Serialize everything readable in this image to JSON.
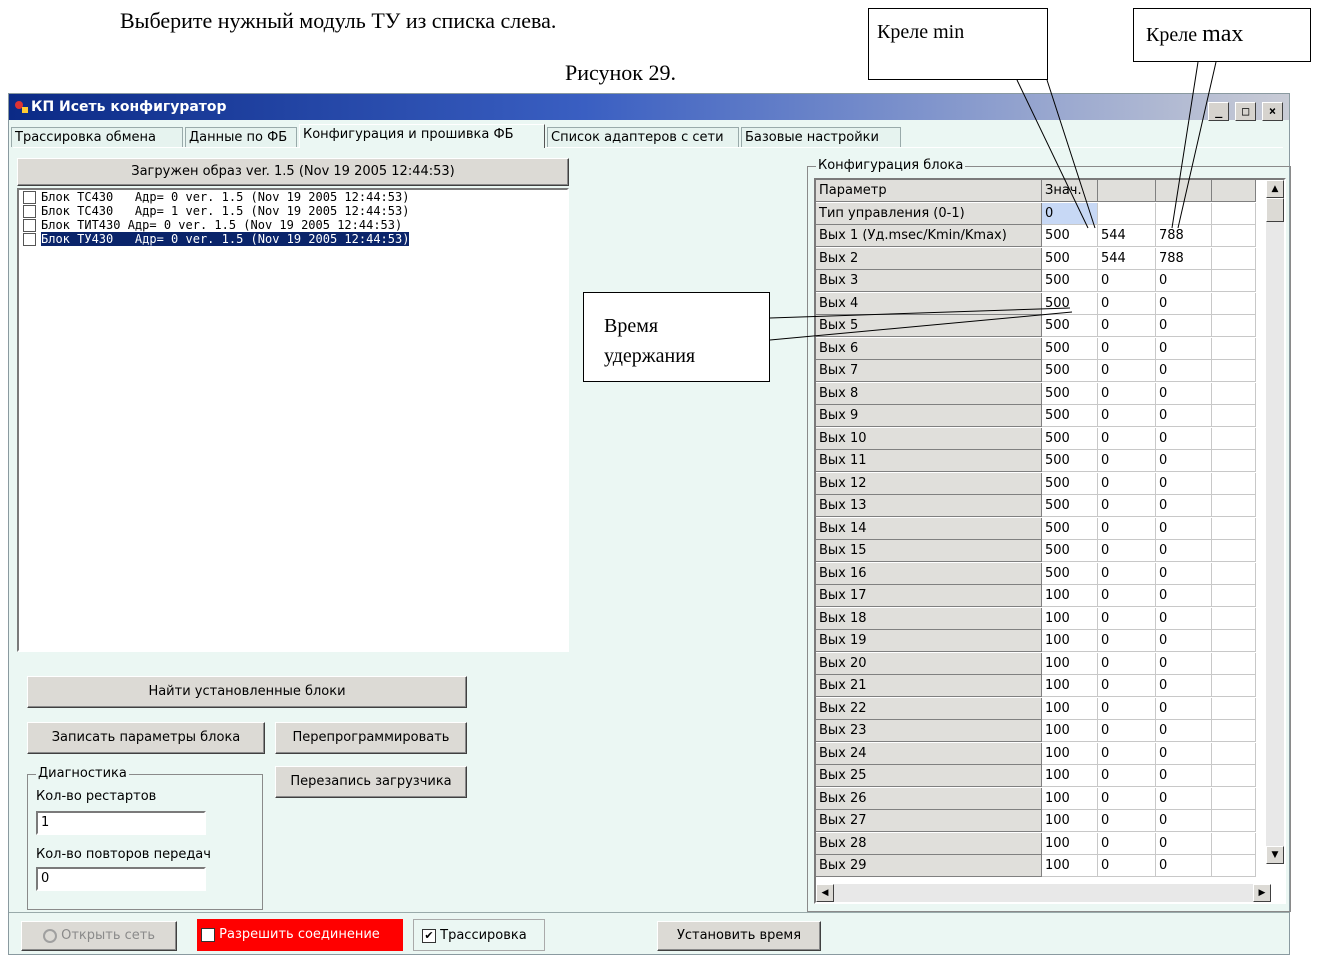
{
  "document": {
    "instruction": "Выберите нужный модуль ТУ из списка слева.",
    "figure_caption": "Рисунок 29."
  },
  "callouts": {
    "krele_min": "Креле min",
    "krele_max_prefix": "Креле ",
    "krele_max_suffix": "max",
    "hold_time_line1": "Время",
    "hold_time_line2": "удержания"
  },
  "window": {
    "title": "КП Исеть конфигуратор",
    "minimize": "_",
    "maximize": "□",
    "close": "×"
  },
  "tabs": [
    {
      "label": "Трассировка обмена"
    },
    {
      "label": "Данные по ФБ"
    },
    {
      "label": "Конфигурация и прошивка ФБ"
    },
    {
      "label": "Список адаптеров с сети"
    },
    {
      "label": "Базовые настройки"
    }
  ],
  "left": {
    "image_loaded": "Загружен образ  ver. 1.5 (Nov 19 2005 12:44:53)",
    "blocks": [
      "Блок ТС430   Адр= 0 ver. 1.5 (Nov 19 2005 12:44:53)",
      "Блок ТС430   Адр= 1 ver. 1.5 (Nov 19 2005 12:44:53)",
      "Блок ТИТ430 Адр= 0 ver. 1.5 (Nov 19 2005 12:44:53)",
      "Блок ТУ430   Адр= 0 ver. 1.5 (Nov 19 2005 12:44:53)"
    ],
    "find_blocks": "Найти установленные блоки",
    "write_params": "Записать параметры блока",
    "reprogram": "Перепрограммировать",
    "rewrite_loader": "Перезапись загрузчика",
    "diagnostics": {
      "title": "Диагностика",
      "restarts_label": "Кол-во рестартов",
      "restarts_value": "1",
      "retries_label": "Кол-во повторов передач",
      "retries_value": "0"
    }
  },
  "config": {
    "title": "Конфигурация блока",
    "headers": [
      "Параметр",
      "Знач.",
      "",
      "",
      ""
    ],
    "rows": [
      [
        "Тип управления (0-1)",
        "0",
        "",
        "",
        ""
      ],
      [
        "Вых 1 (Уд.msec/Kmin/Kmax)",
        "500",
        "544",
        "788",
        ""
      ],
      [
        "Вых 2",
        "500",
        "544",
        "788",
        ""
      ],
      [
        "Вых 3",
        "500",
        "0",
        "0",
        ""
      ],
      [
        "Вых 4",
        "500",
        "0",
        "0",
        ""
      ],
      [
        "Вых 5",
        "500",
        "0",
        "0",
        ""
      ],
      [
        "Вых 6",
        "500",
        "0",
        "0",
        ""
      ],
      [
        "Вых 7",
        "500",
        "0",
        "0",
        ""
      ],
      [
        "Вых 8",
        "500",
        "0",
        "0",
        ""
      ],
      [
        "Вых 9",
        "500",
        "0",
        "0",
        ""
      ],
      [
        "Вых 10",
        "500",
        "0",
        "0",
        ""
      ],
      [
        "Вых 11",
        "500",
        "0",
        "0",
        ""
      ],
      [
        "Вых 12",
        "500",
        "0",
        "0",
        ""
      ],
      [
        "Вых 13",
        "500",
        "0",
        "0",
        ""
      ],
      [
        "Вых 14",
        "500",
        "0",
        "0",
        ""
      ],
      [
        "Вых 15",
        "500",
        "0",
        "0",
        ""
      ],
      [
        "Вых 16",
        "500",
        "0",
        "0",
        ""
      ],
      [
        "Вых 17",
        "100",
        "0",
        "0",
        ""
      ],
      [
        "Вых 18",
        "100",
        "0",
        "0",
        ""
      ],
      [
        "Вых 19",
        "100",
        "0",
        "0",
        ""
      ],
      [
        "Вых 20",
        "100",
        "0",
        "0",
        ""
      ],
      [
        "Вых 21",
        "100",
        "0",
        "0",
        ""
      ],
      [
        "Вых 22",
        "100",
        "0",
        "0",
        ""
      ],
      [
        "Вых 23",
        "100",
        "0",
        "0",
        ""
      ],
      [
        "Вых 24",
        "100",
        "0",
        "0",
        ""
      ],
      [
        "Вых 25",
        "100",
        "0",
        "0",
        ""
      ],
      [
        "Вых 26",
        "100",
        "0",
        "0",
        ""
      ],
      [
        "Вых 27",
        "100",
        "0",
        "0",
        ""
      ],
      [
        "Вых 28",
        "100",
        "0",
        "0",
        ""
      ],
      [
        "Вых 29",
        "100",
        "0",
        "0",
        ""
      ]
    ]
  },
  "statusbar": {
    "open_network": "Открыть сеть",
    "allow_connection": "Разрешить соединение",
    "allow_connection_color": "#ff0000",
    "tracing": "Трассировка",
    "set_time": "Установить время"
  }
}
